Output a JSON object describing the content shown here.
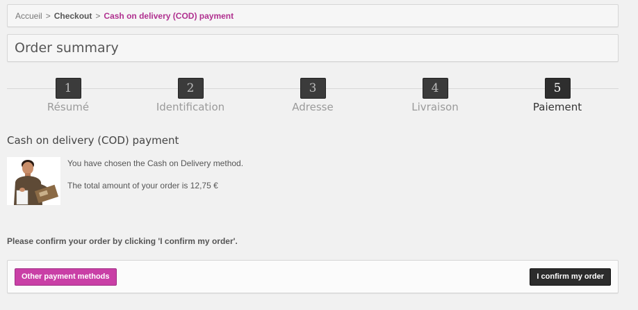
{
  "breadcrumb": {
    "home": "Accueil",
    "separator": ">",
    "checkout": "Checkout",
    "current": "Cash on delivery (COD) payment"
  },
  "page_title": "Order summary",
  "steps": [
    {
      "number": "1",
      "label": "Résumé"
    },
    {
      "number": "2",
      "label": "Identification"
    },
    {
      "number": "3",
      "label": "Adresse"
    },
    {
      "number": "4",
      "label": "Livraison"
    },
    {
      "number": "5",
      "label": "Paiement"
    }
  ],
  "active_step": 5,
  "section_title": "Cash on delivery (COD) payment",
  "info": {
    "chosen": "You have chosen the Cash on Delivery method.",
    "total": "The total amount of your order is 12,75 €"
  },
  "confirm_prompt": "Please confirm your order by clicking 'I confirm my order'.",
  "actions": {
    "other_methods": "Other payment methods",
    "confirm": "I confirm my order"
  },
  "colors": {
    "accent": "#c93fa6",
    "breadcrumb_current": "#b0308f",
    "dark_button": "#2c2c2c"
  }
}
